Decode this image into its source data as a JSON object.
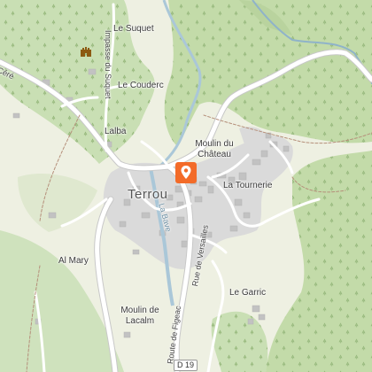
{
  "map": {
    "place_labels": {
      "le_suquet": "Le Suquet",
      "le_couderc": "Le Couderc",
      "lalba": "Lalba",
      "moulin_du_chateau": "Moulin du Château",
      "terrou": "Terrou",
      "la_tournerie": "La Tournerie",
      "al_mary": "Al Mary",
      "le_garric": "Le Garric",
      "moulin_de_lacalm": "Moulin de Lacalm"
    },
    "road_labels": {
      "impasse_du_suquet": "Impasse du Suquet",
      "route_cere": "Céré",
      "rue_de_versailles": "Rue de Versailles",
      "route_de_figeac": "Route de Figeac",
      "la_bave": "La Bave",
      "d19": "D 19"
    },
    "icons": {
      "location_marker": "map-pin-icon",
      "castle": "castle-icon"
    },
    "colors": {
      "background": "#eef0e2",
      "forest": "#c9dfb4",
      "forest_dark": "#b9d39e",
      "built_area": "#d9d9d9",
      "building": "#c2c2c2",
      "road": "#ffffff",
      "river": "#aac7d8",
      "marker": "#f36b28"
    }
  }
}
